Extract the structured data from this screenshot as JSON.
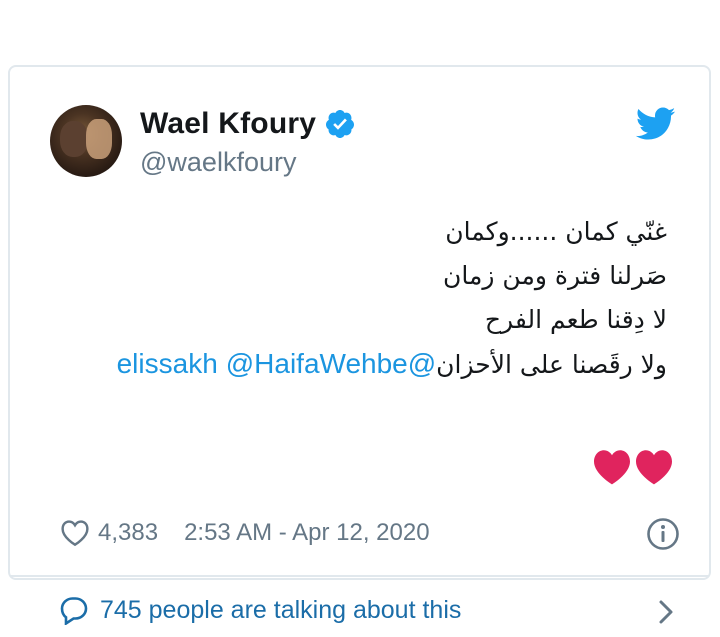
{
  "author": {
    "name": "Wael Kfoury",
    "handle": "@waelkfoury",
    "verified": true
  },
  "tweet": {
    "lines": [
      "غنّي كمان ......وكمان",
      "صَرلنا فترة ومن زمان",
      "لا دِقنا طعم الفرح",
      "ولا رقَصنا على الأحزان"
    ],
    "mentions": [
      "@HaifaWehbe",
      "@elissakh"
    ],
    "emoji": "❤❤"
  },
  "meta": {
    "likes": "4,383",
    "timestamp": "2:53 AM - Apr 12, 2020"
  },
  "footer": {
    "talking": "745 people are talking about this"
  },
  "colors": {
    "twitter_blue": "#1da1f2",
    "link": "#1b95e0",
    "muted": "#657786",
    "heart_red": "#e0245e",
    "border": "#e1e8ed"
  },
  "icons": [
    "verified-badge-icon",
    "twitter-bird-icon",
    "heart-outline-icon",
    "info-icon",
    "speech-bubble-icon",
    "chevron-right-icon",
    "red-heart-emoji"
  ]
}
